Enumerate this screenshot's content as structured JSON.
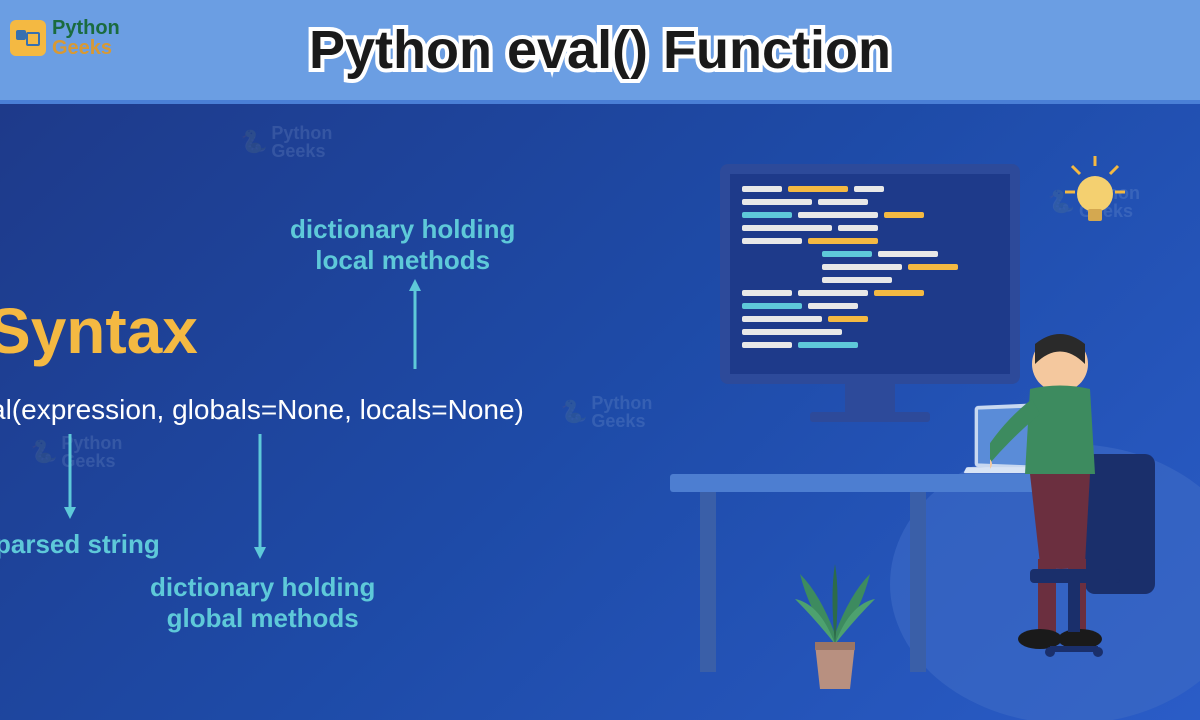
{
  "logo": {
    "line1": "Python",
    "line2": "Geeks"
  },
  "title": "Python eval() Function",
  "syntax": {
    "label": "Syntax",
    "code": "al(expression, globals=None, locals=None)"
  },
  "annotations": {
    "locals": "dictionary holding\nlocal methods",
    "expression": "parsed string",
    "globals": "dictionary holding\nglobal methods"
  },
  "watermarks": {
    "text": "Python\nGeeks"
  }
}
